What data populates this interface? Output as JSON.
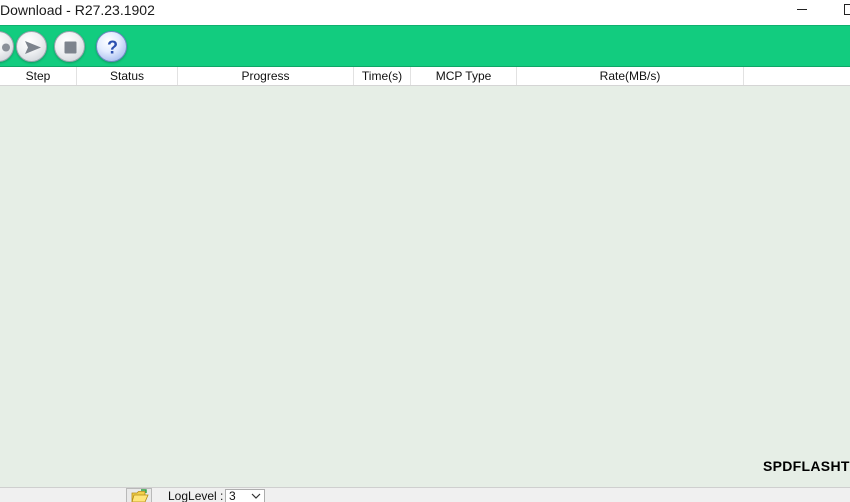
{
  "window": {
    "title": "Download - R27.23.1902"
  },
  "toolbar": {
    "buttons": [
      {
        "name": "partial-button",
        "icon": "gear-icon"
      },
      {
        "name": "start-download-button",
        "icon": "play-arrow-icon"
      },
      {
        "name": "stop-download-button",
        "icon": "stop-square-icon"
      },
      {
        "name": "help-button",
        "icon": "question-mark-icon"
      }
    ],
    "accent_color": "#12cc7f"
  },
  "table": {
    "columns": [
      "Step",
      "Status",
      "Progress",
      "Time(s)",
      "MCP Type",
      "Rate(MB/s)"
    ],
    "rows": []
  },
  "list_background": "#e6eee6",
  "watermark": "SPDFLASHTO",
  "statusbar": {
    "loglevel_label": "LogLevel :",
    "loglevel_value": "3"
  }
}
